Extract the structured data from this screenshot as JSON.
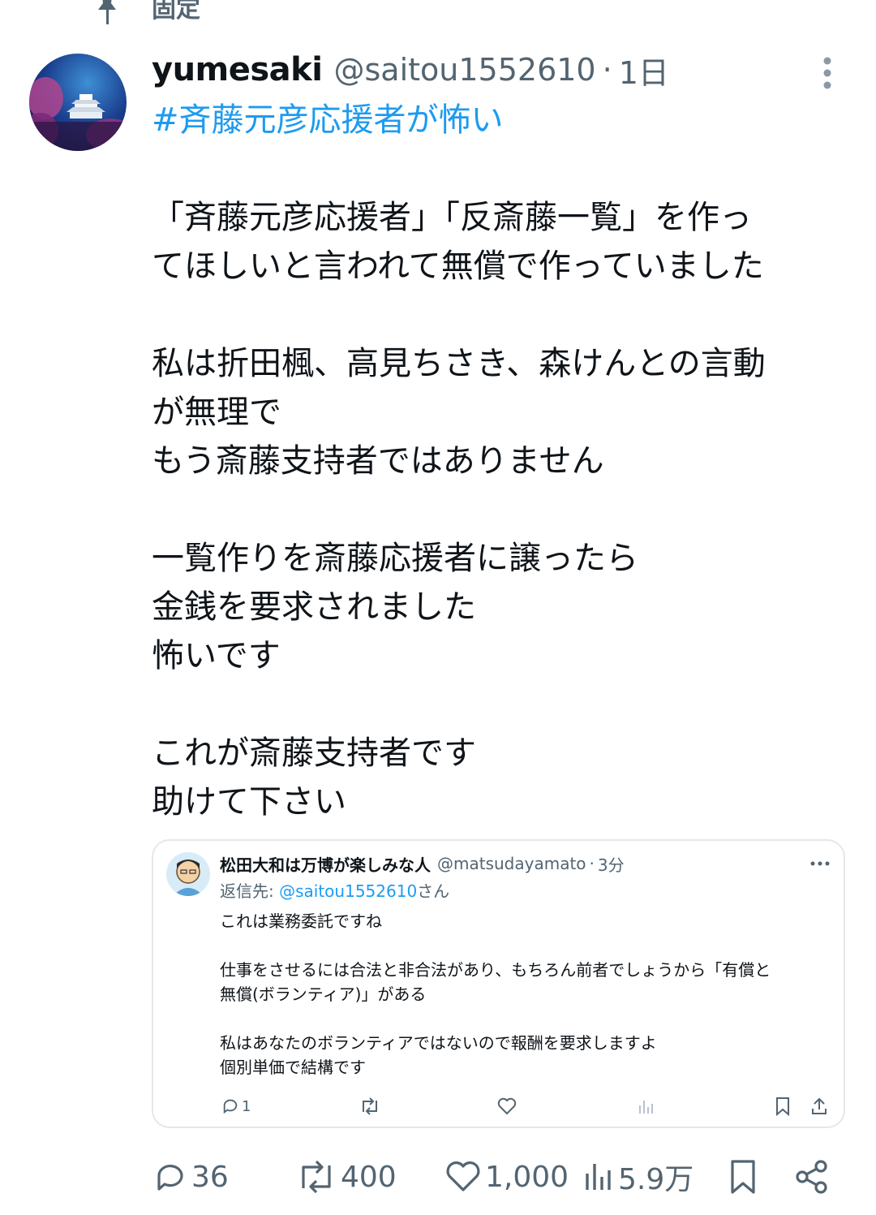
{
  "pinned": {
    "label": "固定",
    "icon": "pin-icon"
  },
  "post": {
    "display_name": "yumesaki",
    "handle": "@saitou1552610",
    "separator": "·",
    "time": "1日",
    "hashtag": "#斉藤元彦応援者が怖い",
    "body_lines": [
      "「斉藤元彦応援者」「反斎藤一覧」を作っ",
      "てほしいと言われて無償で作っていました",
      "私は折田楓、高見ちさき、森けんとの言動",
      "が無理で",
      "もう斎藤支持者ではありません",
      "一覧作りを斎藤応援者に譲ったら",
      "金銭を要求されました",
      "怖いです",
      "これが斎藤支持者です",
      "助けて下さい"
    ]
  },
  "quoted": {
    "display_name": "松田大和は万博が楽しみな人",
    "handle": "@matsudayamato",
    "separator": "·",
    "time": "3分",
    "reply_prefix": "返信先: ",
    "reply_mention": "@saitou1552610",
    "reply_suffix": "さん",
    "body_lines": [
      "これは業務委託ですね",
      "仕事をさせるには合法と非合法があり、もちろん前者でしょうから「有償と",
      "無償(ボランティア)」がある",
      "私はあなたのボランティアではないので報酬を要求しますよ",
      "個別単価で結構です"
    ],
    "actions": {
      "reply_count": "1"
    }
  },
  "actions": {
    "replies": "36",
    "reposts": "400",
    "likes": "1,000",
    "views": "5.9万"
  },
  "colors": {
    "accent": "#1d9bf0",
    "text": "#0f1419",
    "muted": "#536471",
    "border": "#e4e8ec"
  },
  "icons": [
    "pin-icon",
    "more-icon",
    "reply-icon",
    "repost-icon",
    "like-icon",
    "views-icon",
    "bookmark-icon",
    "share-icon"
  ]
}
